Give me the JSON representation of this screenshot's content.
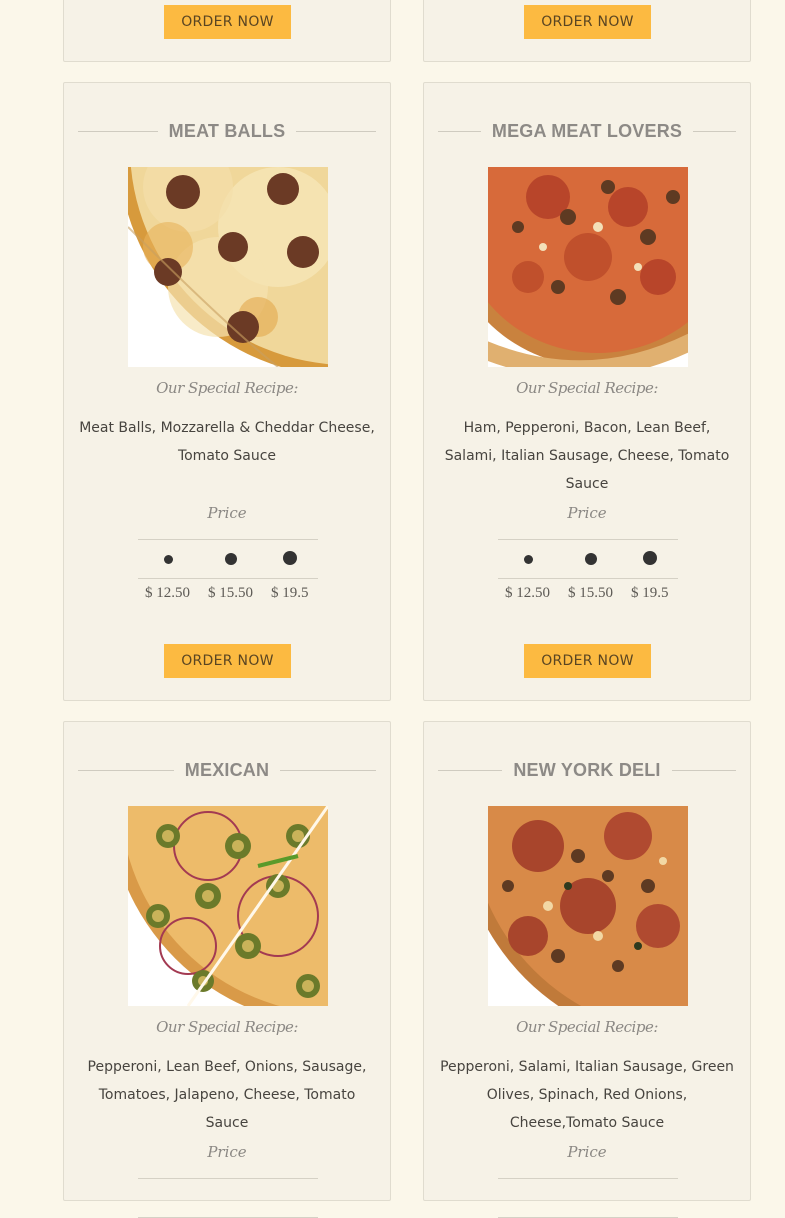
{
  "order_label": "ORDER NOW",
  "colors": {
    "button": "#fcba41",
    "card": "#f6f2e7",
    "page": "#fbf7ea"
  },
  "cards": [
    {
      "title": "MEAT BALLS",
      "recipe_label": "Our Special Recipe:",
      "ingredients": "Meat Balls, Mozzarella & Cheddar Cheese, Tomato Sauce",
      "price_label": "Price",
      "prices": [
        "$ 12.50",
        "$ 15.50",
        "$ 19.5"
      ],
      "order_label": "ORDER NOW"
    },
    {
      "title": "MEGA MEAT LOVERS",
      "recipe_label": "Our Special Recipe:",
      "ingredients": "Ham, Pepperoni, Bacon, Lean Beef, Salami, Italian Sausage, Cheese, Tomato Sauce",
      "price_label": "Price",
      "prices": [
        "$ 12.50",
        "$ 15.50",
        "$ 19.5"
      ],
      "order_label": "ORDER NOW"
    },
    {
      "title": "MEXICAN",
      "recipe_label": "Our Special Recipe:",
      "ingredients": "Pepperoni, Lean Beef, Onions, Sausage, Tomatoes, Jalapeno, Cheese, Tomato Sauce",
      "price_label": "Price"
    },
    {
      "title": "NEW YORK DELI",
      "recipe_label": "Our Special Recipe:",
      "ingredients": "Pepperoni, Salami, Italian Sausage, Green Olives, Spinach, Red Onions, Cheese,Tomato Sauce",
      "price_label": "Price"
    }
  ]
}
